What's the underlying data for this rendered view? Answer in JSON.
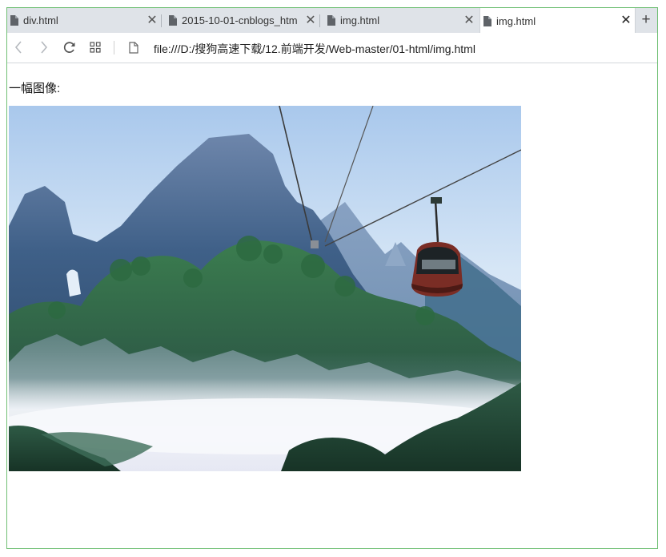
{
  "tabs": [
    {
      "title": "div.html",
      "active": false
    },
    {
      "title": "2015-10-01-cnblogs_htm",
      "active": false
    },
    {
      "title": "img.html",
      "active": false
    },
    {
      "title": "img.html",
      "active": true
    }
  ],
  "toolbar": {
    "url": "file:///D:/搜狗高速下载/12.前端开发/Web-master/01-html/img.html"
  },
  "icons": {
    "back": "arrow-left-icon",
    "forward": "arrow-right-icon",
    "reload": "reload-icon",
    "apps": "grid-icon",
    "page": "document-icon",
    "close": "close-icon",
    "new_tab": "plus-icon"
  },
  "colors": {
    "window_border": "#6fbf73",
    "tabbar_bg": "#dfe3e8"
  },
  "page": {
    "caption": "一幅图像:",
    "image_description": "mountain peaks with a cable car"
  }
}
